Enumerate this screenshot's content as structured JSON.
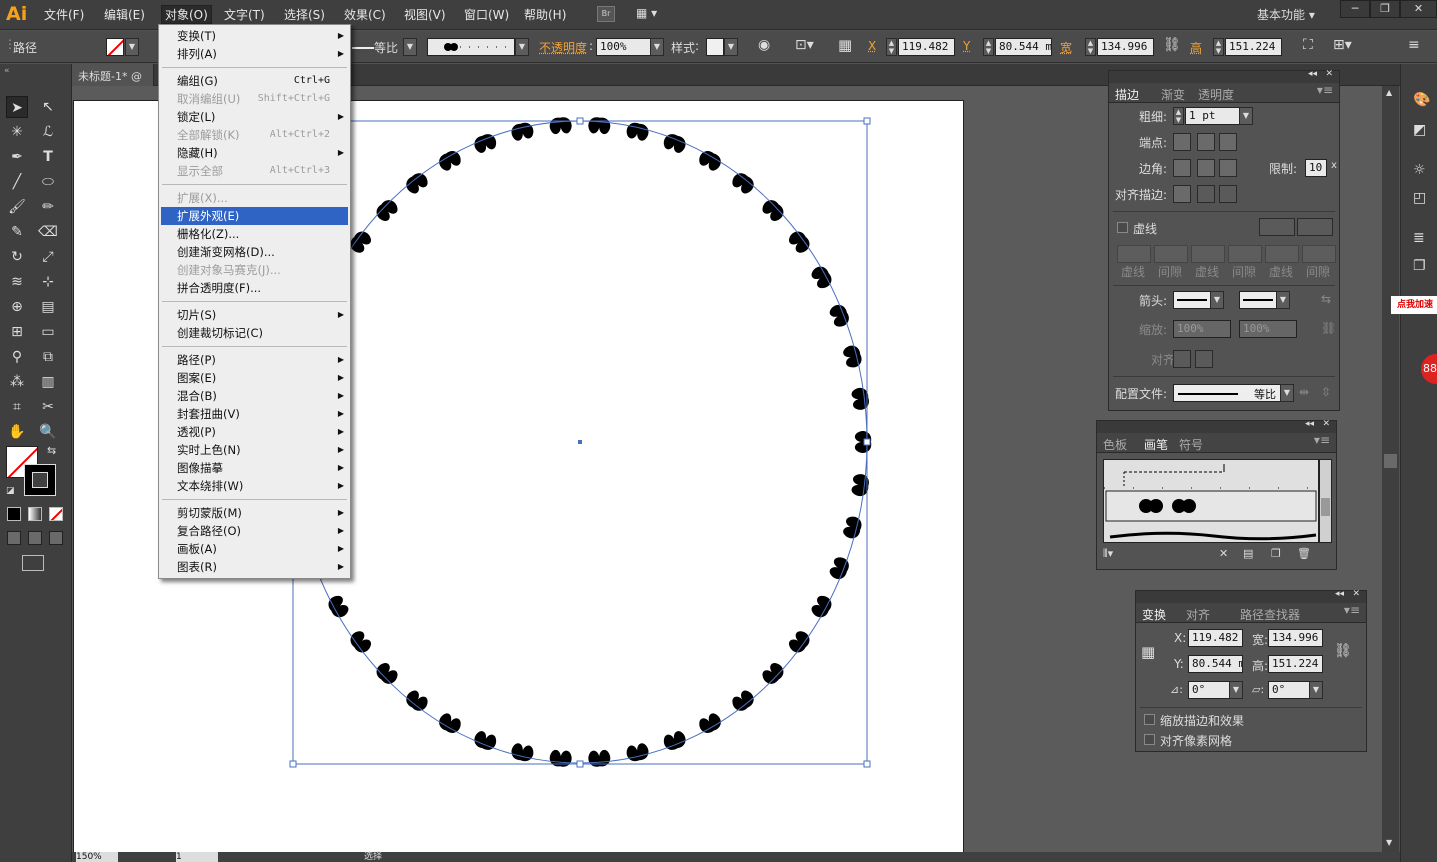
{
  "app": {
    "logo": "Ai",
    "workspace": "基本功能",
    "br_badge": "Br"
  },
  "menubar": {
    "items": [
      "文件(F)",
      "编辑(E)",
      "对象(O)",
      "文字(T)",
      "选择(S)",
      "效果(C)",
      "视图(V)",
      "窗口(W)",
      "帮助(H)"
    ],
    "selected_index": 2
  },
  "control_bar": {
    "object_type": "路径",
    "stroke_profile": "等比",
    "opacity_label": "不透明度",
    "opacity_value": "100%",
    "style_label": "样式",
    "x_label": "X",
    "x_value": "119.482",
    "y_label": "Y",
    "y_value": "80.544 m",
    "w_label": "宽",
    "w_value": "134.996",
    "h_label": "高",
    "h_value": "151.224"
  },
  "document": {
    "tab_title": "未标题-1* @",
    "zoom": "150%",
    "artboard_num": "1",
    "status_text": "选择"
  },
  "object_menu": {
    "groups": [
      [
        {
          "label": "变换(T)",
          "arrow": true
        },
        {
          "label": "排列(A)",
          "arrow": true
        }
      ],
      [
        {
          "label": "编组(G)",
          "shortcut": "Ctrl+G"
        },
        {
          "label": "取消编组(U)",
          "shortcut": "Shift+Ctrl+G",
          "disabled": true
        },
        {
          "label": "锁定(L)",
          "arrow": true
        },
        {
          "label": "全部解锁(K)",
          "shortcut": "Alt+Ctrl+2",
          "disabled": true
        },
        {
          "label": "隐藏(H)",
          "arrow": true
        },
        {
          "label": "显示全部",
          "shortcut": "Alt+Ctrl+3",
          "disabled": true
        }
      ],
      [
        {
          "label": "扩展(X)...",
          "disabled": true
        },
        {
          "label": "扩展外观(E)",
          "highlighted": true
        },
        {
          "label": "栅格化(Z)..."
        },
        {
          "label": "创建渐变网格(D)..."
        },
        {
          "label": "创建对象马赛克(J)...",
          "disabled": true
        },
        {
          "label": "拼合透明度(F)..."
        }
      ],
      [
        {
          "label": "切片(S)",
          "arrow": true
        },
        {
          "label": "创建裁切标记(C)"
        }
      ],
      [
        {
          "label": "路径(P)",
          "arrow": true
        },
        {
          "label": "图案(E)",
          "arrow": true
        },
        {
          "label": "混合(B)",
          "arrow": true
        },
        {
          "label": "封套扭曲(V)",
          "arrow": true
        },
        {
          "label": "透视(P)",
          "arrow": true
        },
        {
          "label": "实时上色(N)",
          "arrow": true
        },
        {
          "label": "图像描摹",
          "arrow": true
        },
        {
          "label": "文本绕排(W)",
          "arrow": true
        }
      ],
      [
        {
          "label": "剪切蒙版(M)",
          "arrow": true
        },
        {
          "label": "复合路径(O)",
          "arrow": true
        },
        {
          "label": "画板(A)",
          "arrow": true
        },
        {
          "label": "图表(R)",
          "arrow": true
        }
      ]
    ]
  },
  "stroke_panel": {
    "tabs": [
      "描边",
      "渐变",
      "透明度"
    ],
    "weight_label": "粗细:",
    "weight_value": "1 pt",
    "cap_label": "端点:",
    "corner_label": "边角:",
    "limit_label": "限制:",
    "limit_value": "10",
    "align_label": "对齐描边:",
    "dashed_label": "虚线",
    "dash_labels": [
      "虚线",
      "间隙",
      "虚线",
      "间隙",
      "虚线",
      "间隙"
    ],
    "arrow_label": "箭头:",
    "scale_label": "缩放:",
    "scale1": "100%",
    "scale2": "100%",
    "align2_label": "对齐:",
    "profile_label": "配置文件:",
    "profile_value": "等比"
  },
  "brush_panel": {
    "tabs": [
      "色板",
      "画笔",
      "符号"
    ]
  },
  "transform_panel": {
    "tabs": [
      "变换",
      "对齐",
      "路径查找器"
    ],
    "x_label": "X:",
    "x_value": "119.482",
    "y_label": "Y:",
    "y_value": "80.544 m",
    "w_label": "宽:",
    "w_value": "134.996",
    "h_label": "高:",
    "h_value": "151.224",
    "rotate_value": "0°",
    "shear_value": "0°",
    "scale_strokes_label": "缩放描边和效果",
    "align_pixel_label": "对齐像素网格"
  },
  "badge": {
    "text": "点我加速",
    "number": "88"
  }
}
